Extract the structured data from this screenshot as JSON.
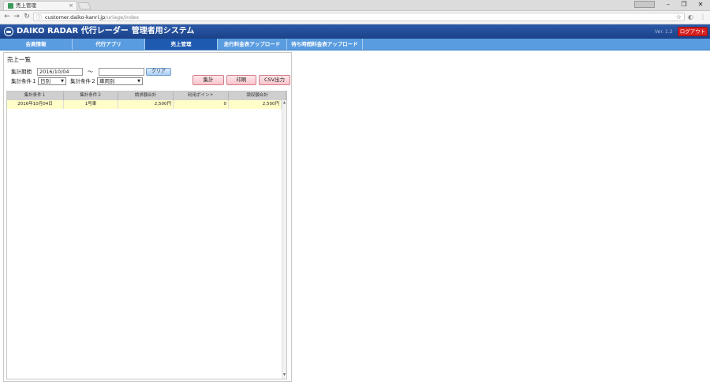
{
  "browser": {
    "tab_title": "売上管理",
    "tab_close": "×",
    "url_host": "customer.daiko-kanri.jp",
    "url_path": "/uriage/index",
    "back": "←",
    "forward": "→",
    "reload": "↻",
    "star": "☆",
    "minimize": "–",
    "maximize": "❐",
    "close": "✕",
    "menu": "⋮"
  },
  "header": {
    "title": "DAIKO RADAR 代行レーダー",
    "subtitle": "管理者用システム",
    "version": "Ver. 1.2",
    "logout_label": "ログアウト"
  },
  "nav": {
    "items": [
      {
        "label": "会員情報"
      },
      {
        "label": "代行アプリ"
      },
      {
        "label": "売上管理"
      },
      {
        "label": "走行料金表アップロード"
      },
      {
        "label": "待ち時間料金表アップロード"
      }
    ],
    "active_index": 2
  },
  "form": {
    "title": "売上一覧",
    "period_label": "集計期間",
    "date_from": "2016/10/04",
    "tilde": "〜",
    "date_to": "",
    "clear_label": "クリア",
    "condition1_label": "集計条件１",
    "condition1_value": "日別",
    "condition2_label": "集計条件２",
    "condition2_value": "車両別",
    "aggregate_label": "集計",
    "print_label": "印刷",
    "csv_label": "CSV出力"
  },
  "table": {
    "columns": [
      "集計条件１",
      "集計条件２",
      "請求額合計",
      "利用ポイント",
      "領収額合計"
    ],
    "rows": [
      [
        "2016年10月04日",
        "1号車",
        "2,500円",
        "0",
        "2,500円"
      ]
    ]
  },
  "colors": {
    "header_bg": "#1c4188",
    "nav_bg": "#5a9ce0",
    "nav_active": "#1e5ab0",
    "logout": "#d62020",
    "row_highlight": "#fffdc8"
  }
}
